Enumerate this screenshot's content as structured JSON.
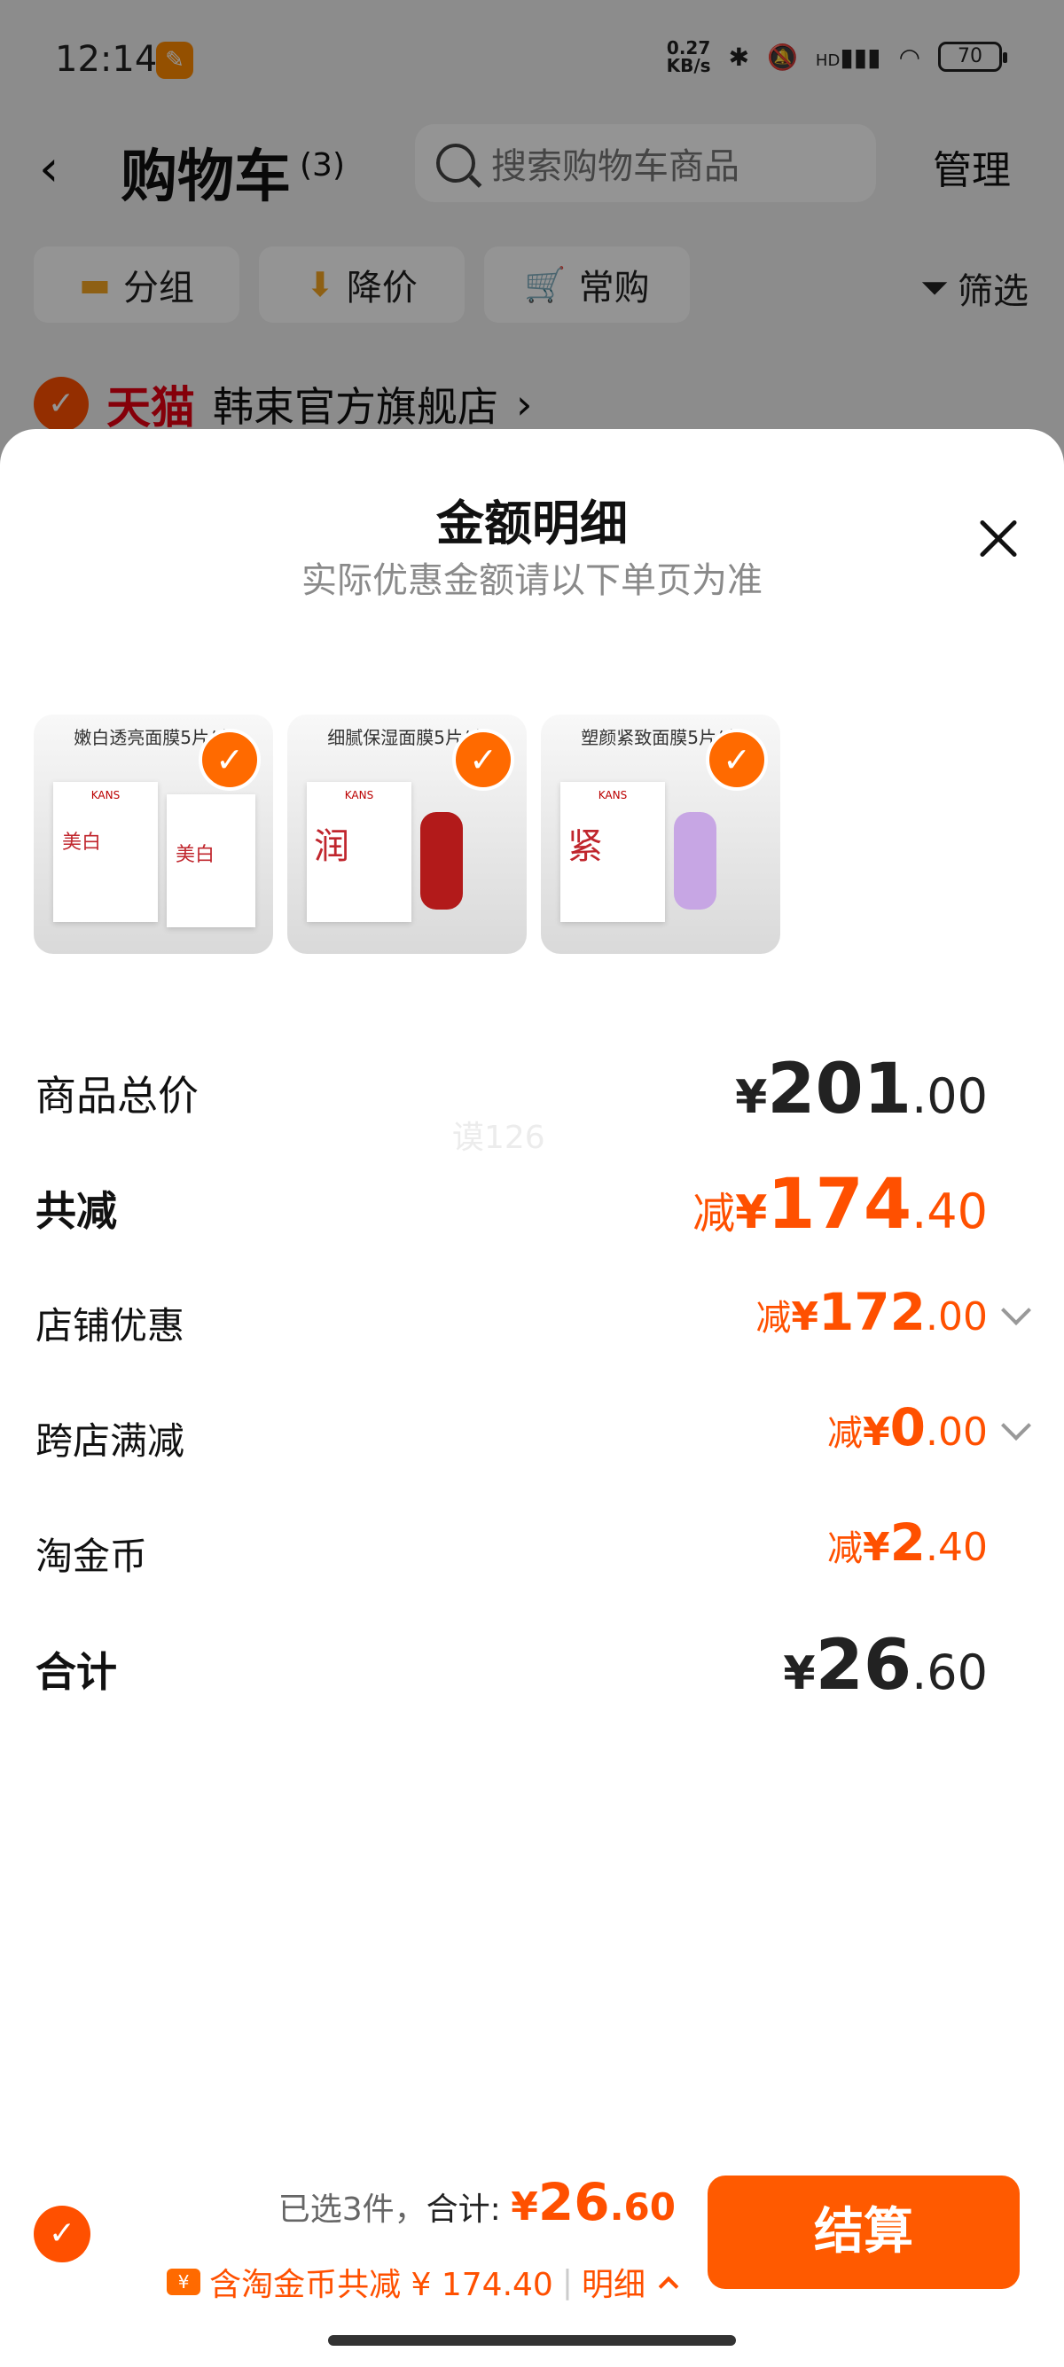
{
  "status_bar": {
    "time": "12:14",
    "net_speed_value": "0.27",
    "net_speed_unit": "KB/s",
    "signal": "HD",
    "battery": "70"
  },
  "header": {
    "title": "购物车",
    "count": "(3)",
    "search_placeholder": "搜索购物车商品",
    "manage": "管理"
  },
  "chips": [
    {
      "icon": "folder-icon",
      "label": "分组"
    },
    {
      "icon": "price-drop-icon",
      "label": "降价"
    },
    {
      "icon": "cart-icon",
      "label": "常购"
    }
  ],
  "filter_label": "筛选",
  "store": {
    "platform": "天猫",
    "name": "韩束官方旗舰店"
  },
  "sheet": {
    "title": "金额明细",
    "subtitle": "实际优惠金额请以下单页为准",
    "products": [
      {
        "caption": "嫩白透亮面膜5片/盒",
        "big_char": "美白",
        "selected": true
      },
      {
        "caption": "细腻保湿面膜5片/盒",
        "big_char": "润",
        "selected": true
      },
      {
        "caption": "塑颜紧致面膜5片/盒",
        "big_char": "紧",
        "selected": true
      }
    ],
    "rows": {
      "total": {
        "label": "商品总价",
        "yen": "¥",
        "int": "201",
        "dec": ".00"
      },
      "discount": {
        "label": "共减",
        "prefix": "减",
        "yen": "¥",
        "int": "174",
        "dec": ".40"
      },
      "store_coupon": {
        "label": "店铺优惠",
        "prefix": "减",
        "yen": "¥",
        "int": "172",
        "dec": ".00"
      },
      "cross_store": {
        "label": "跨店满减",
        "prefix": "减",
        "yen": "¥",
        "int": "0",
        "dec": ".00"
      },
      "taojinbi": {
        "label": "淘金币",
        "prefix": "减",
        "yen": "¥",
        "int": "2",
        "dec": ".40"
      },
      "sum": {
        "label": "合计",
        "yen": "¥",
        "int": "26",
        "dec": ".60"
      }
    },
    "watermark": "谟126"
  },
  "bottom_bar": {
    "selected_text": "已选3件，",
    "sum_label": "合计: ",
    "sum_yen": "¥",
    "sum_int": "26",
    "sum_dec": ".60",
    "coin_text": "含淘金币共减 ¥ 174.40",
    "detail_text": "明细",
    "checkout": "结算"
  },
  "colors": {
    "accent": "#ff5000",
    "checkout": "#ff5a00",
    "tmall_red": "#e60012"
  }
}
